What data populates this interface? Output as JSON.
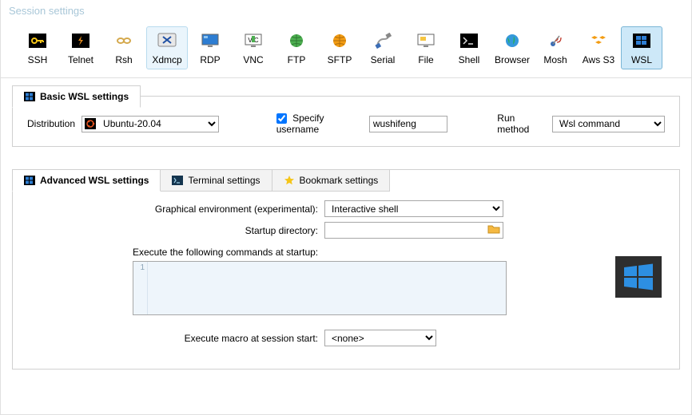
{
  "window": {
    "title": "Session settings"
  },
  "session_types": [
    {
      "id": "ssh",
      "label": "SSH"
    },
    {
      "id": "telnet",
      "label": "Telnet"
    },
    {
      "id": "rsh",
      "label": "Rsh"
    },
    {
      "id": "xdmcp",
      "label": "Xdmcp"
    },
    {
      "id": "rdp",
      "label": "RDP"
    },
    {
      "id": "vnc",
      "label": "VNC"
    },
    {
      "id": "ftp",
      "label": "FTP"
    },
    {
      "id": "sftp",
      "label": "SFTP"
    },
    {
      "id": "serial",
      "label": "Serial"
    },
    {
      "id": "file",
      "label": "File"
    },
    {
      "id": "shell",
      "label": "Shell"
    },
    {
      "id": "browser",
      "label": "Browser"
    },
    {
      "id": "mosh",
      "label": "Mosh"
    },
    {
      "id": "awss3",
      "label": "Aws S3"
    },
    {
      "id": "wsl",
      "label": "WSL"
    }
  ],
  "basic": {
    "tab_label": "Basic WSL settings",
    "distribution_label": "Distribution",
    "distribution_value": "Ubuntu-20.04",
    "specify_username_label": "Specify username",
    "specify_username_checked": true,
    "username_value": "wushifeng",
    "run_method_label": "Run method",
    "run_method_value": "Wsl command"
  },
  "advanced": {
    "tabs": [
      {
        "id": "adv",
        "label": "Advanced WSL settings",
        "active": true
      },
      {
        "id": "term",
        "label": "Terminal settings",
        "active": false
      },
      {
        "id": "book",
        "label": "Bookmark settings",
        "active": false
      }
    ],
    "graphical_label": "Graphical environment (experimental):",
    "graphical_value": "Interactive shell",
    "startup_dir_label": "Startup directory:",
    "startup_dir_value": "",
    "startup_cmds_label": "Execute the following commands at startup:",
    "startup_cmds_line1": "1",
    "macro_label": "Execute macro at session start:",
    "macro_value": "<none>"
  }
}
